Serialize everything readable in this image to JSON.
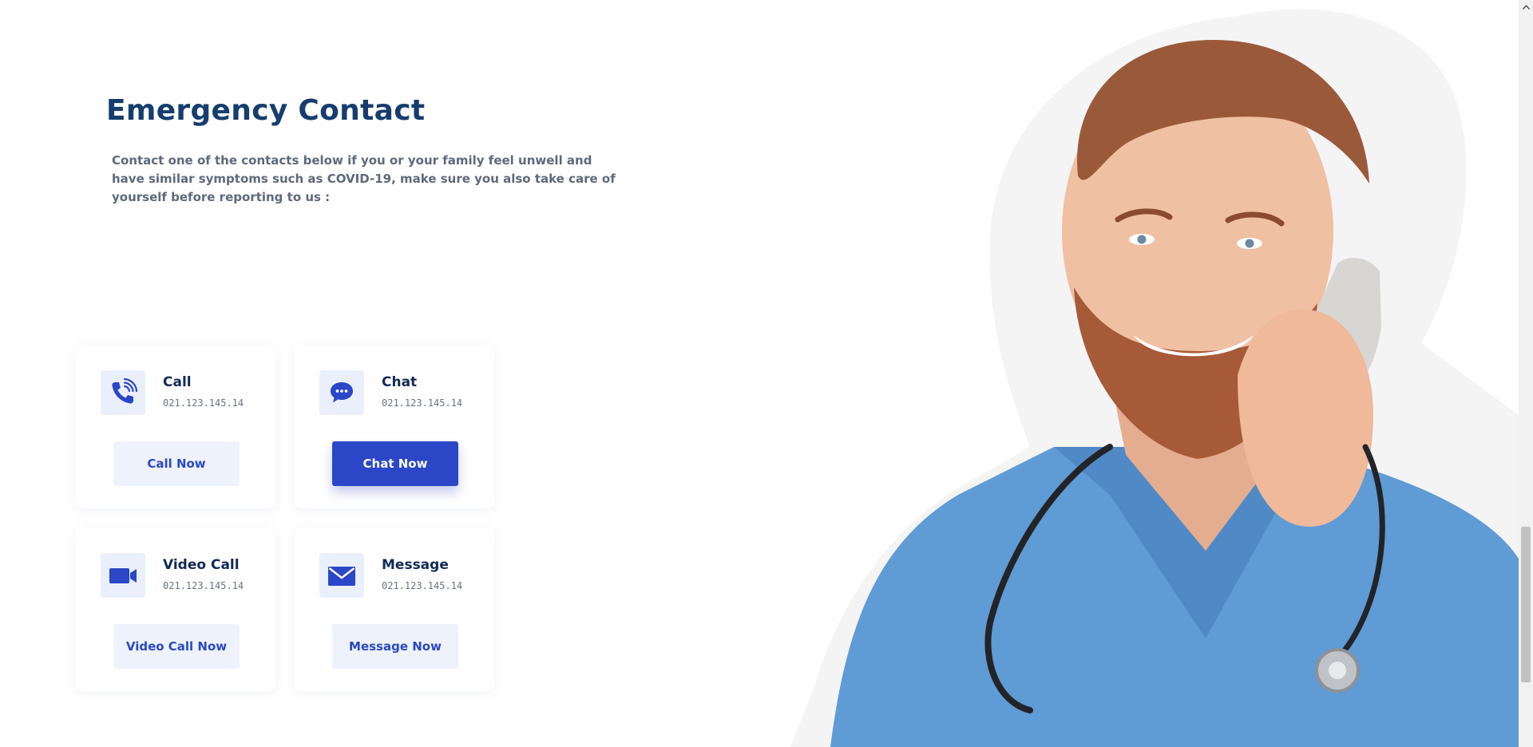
{
  "section": {
    "title": "Emergency Contact",
    "description": "Contact one of the contacts below if you or your family feel unwell and have similar symptoms such as COVID-19, make sure you also take care of yourself before reporting to us :"
  },
  "contacts": [
    {
      "title": "Call",
      "number": "021.123.145.14",
      "button": "Call Now",
      "icon": "phone-icon",
      "primary": false
    },
    {
      "title": "Chat",
      "number": "021.123.145.14",
      "button": "Chat Now",
      "icon": "chat-bubble-icon",
      "primary": true
    },
    {
      "title": "Video Call",
      "number": "021.123.145.14",
      "button": "Video Call Now",
      "icon": "video-camera-icon",
      "primary": false
    },
    {
      "title": "Message",
      "number": "021.123.145.14",
      "button": "Message Now",
      "icon": "envelope-icon",
      "primary": false
    }
  ],
  "colors": {
    "accent": "#2b46c6",
    "title": "#163d6e",
    "icon_bg": "#eaf0fb",
    "button_light": "#eef2fc",
    "scrub_blue": "#5f9bd5"
  },
  "image": {
    "subject": "doctor-on-phone-illustration"
  }
}
